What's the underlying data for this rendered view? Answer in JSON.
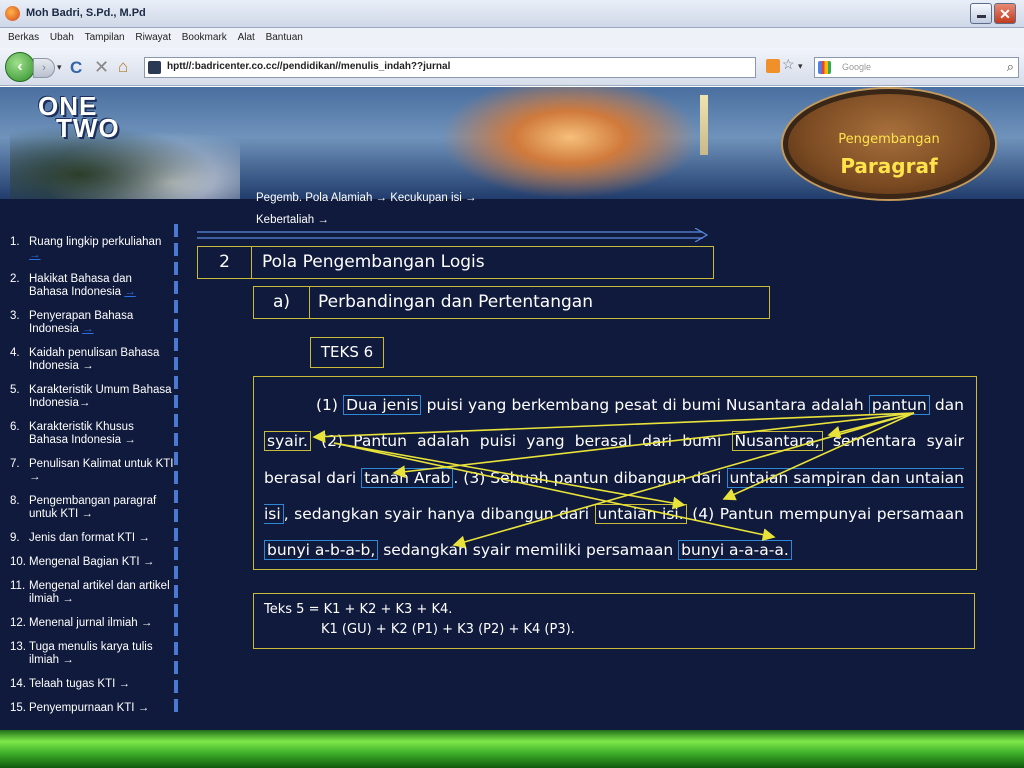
{
  "window": {
    "title": "Moh Badri, S.Pd., M.Pd",
    "close_glyph": "✕"
  },
  "menu": [
    "Berkas",
    "Ubah",
    "Tampilan",
    "Riwayat",
    "Bookmark",
    "Alat",
    "Bantuan"
  ],
  "nav": {
    "back_glyph": "‹",
    "forward_glyph": "›",
    "reload_glyph": "C",
    "stop_glyph": "✕",
    "home_glyph": "⌂",
    "url": "hptt//:badricenter.co.cc//pendidikan//menulis_indah??jurnal",
    "search_placeholder": "Google",
    "search_glyph": "⌕",
    "star_glyph": "☆",
    "dropdown_glyph": "▾"
  },
  "banner": {
    "logo_line1": "ONE",
    "logo_line2": "TWO",
    "badge_subtitle": "Pengembangan",
    "badge_title": "Paragraf"
  },
  "breadcrumb": {
    "line1": "Pegemb. Pola Alamiah →  Kecukupan isi →",
    "line2": "Kebertaliah →"
  },
  "sidebar": {
    "items": [
      {
        "num": "1.",
        "label": "Ruang lingkip perkuliahan",
        "arrow": "→",
        "arrow_is_link": true
      },
      {
        "num": "2.",
        "label": "Hakikat Bahasa dan Bahasa Indonesia",
        "arrow": "→",
        "arrow_is_link": true
      },
      {
        "num": "3.",
        "label": "Penyerapan Bahasa Indonesia",
        "arrow": "→",
        "arrow_is_link": true
      },
      {
        "num": "4.",
        "label": "Kaidah penulisan Bahasa Indonesia",
        "arrow": "→",
        "arrow_is_link": false
      },
      {
        "num": "5.",
        "label": "Karakteristik Umum Bahasa Indonesia",
        "arrow": "→",
        "arrow_is_link": false
      },
      {
        "num": "6.",
        "label": "Karakteristik Khusus Bahasa Indonesia",
        "arrow": "→",
        "arrow_is_link": false
      },
      {
        "num": "7.",
        "label": "Penulisan Kalimat untuk KTI",
        "arrow": "→",
        "arrow_is_link": false
      },
      {
        "num": "8.",
        "label": "Pengembangan paragraf untuk KTI",
        "arrow": "→",
        "arrow_is_link": false
      },
      {
        "num": "9.",
        "label": "Jenis dan format KTI",
        "arrow": "→",
        "arrow_is_link": false
      },
      {
        "num": "10.",
        "label": "Mengenal Bagian KTI",
        "arrow": "→",
        "arrow_is_link": false
      },
      {
        "num": "11.",
        "label": "Mengenal artikel dan artikel ilmiah",
        "arrow": "→",
        "arrow_is_link": false
      },
      {
        "num": "12.",
        "label": "Menenal jurnal ilmiah",
        "arrow": "→",
        "arrow_is_link": false
      },
      {
        "num": "13.",
        "label": "Tuga menulis karya tulis ilmiah",
        "arrow": "→",
        "arrow_is_link": false
      },
      {
        "num": "14.",
        "label": "Telaah tugas KTI",
        "arrow": "→",
        "arrow_is_link": false
      },
      {
        "num": "15.",
        "label": "Penyempurnaan KTI",
        "arrow": "→",
        "arrow_is_link": false
      }
    ]
  },
  "content": {
    "section_num": "2",
    "section_title": "Pola Pengembangan Logis",
    "sub_num": "a)",
    "sub_title": "Perbandingan dan Pertentangan",
    "teks_label": "TEKS 6",
    "paragraph": {
      "p1": "(1) ",
      "h1": "Dua jenis",
      "p2": " puisi yang berkembang pesat di bumi Nusantara adalah ",
      "h2": "pantun",
      "p3": " dan ",
      "h3": "syair.",
      "p4": " (2) Pantun adalah puisi yang berasal dari bumi ",
      "h4": "Nusantara,",
      "p5": " sementara syair berasal dari ",
      "h5": "tanah Arab",
      "p6": ". (3) Sebuah pantun dibangun dari ",
      "h6": "untaian sampiran dan untaian isi",
      "p7": ", sedangkan syair hanya dibangun dari ",
      "h7": "untaian isi.",
      "p8": " (4) Pantun mempunyai persamaan ",
      "h8": "bunyi a-b-a-b,",
      "p9": " sedangkan syair memiliki persamaan ",
      "h9": "bunyi a-a-a-a."
    },
    "formula_line1": "Teks 5 = K1 + K2 + K3 + K4.",
    "formula_line2": "K1 (GU) + K2  (P1) + K3 (P2) + K4 (P3)."
  },
  "colors": {
    "page_bg": "#101a3c",
    "box_border": "#c9bb3a",
    "highlight_blue": "#2e88d6",
    "badge_text": "#ffe34a",
    "link_blue": "#2b6fe0",
    "bottom_bar": "#3fb12a"
  }
}
